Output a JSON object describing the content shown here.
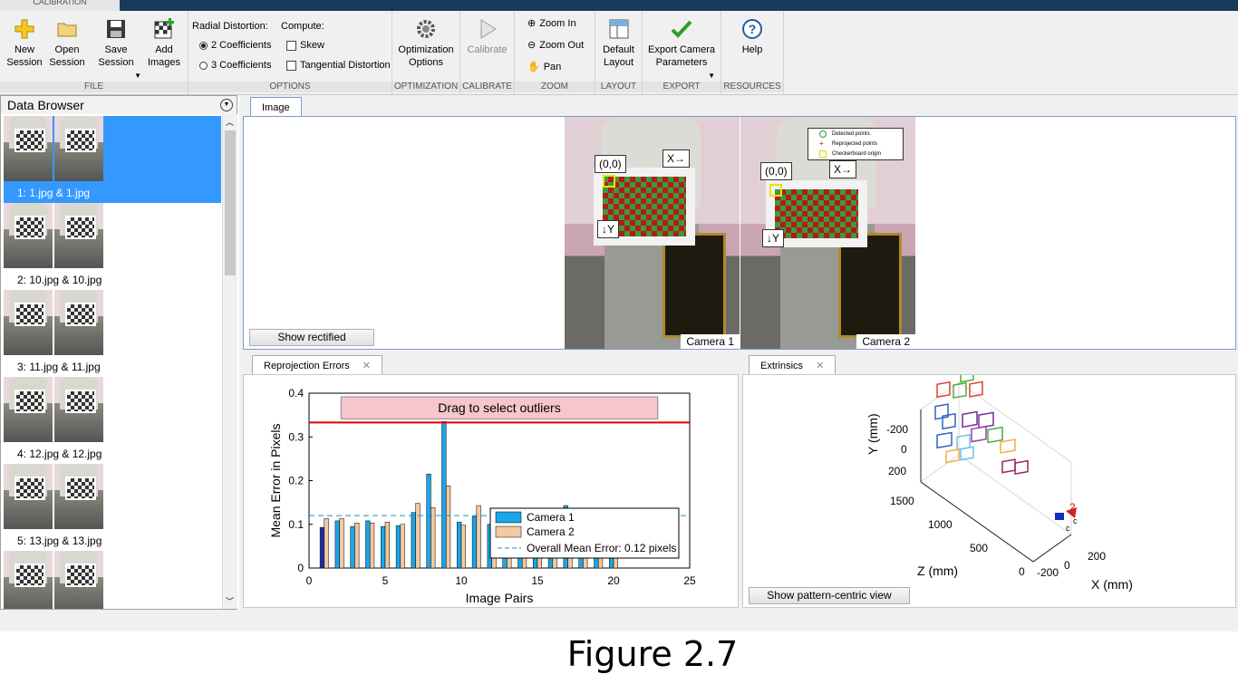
{
  "app_tab": "CALIBRATION",
  "ribbon": {
    "file": {
      "label": "FILE",
      "new_session": "New\nSession",
      "open_session": "Open\nSession",
      "save_session": "Save\nSession",
      "add_images": "Add\nImages"
    },
    "options": {
      "label": "OPTIONS",
      "radial_title": "Radial Distortion:",
      "compute_title": "Compute:",
      "two_coeff": "2 Coefficients",
      "three_coeff": "3 Coefficients",
      "skew": "Skew",
      "tangential": "Tangential Distortion"
    },
    "optimization": {
      "label": "OPTIMIZATION",
      "button": "Optimization\nOptions"
    },
    "calibrate": {
      "label": "CALIBRATE",
      "button": "Calibrate"
    },
    "zoom": {
      "label": "ZOOM",
      "zoom_in": "Zoom In",
      "zoom_out": "Zoom Out",
      "pan": "Pan"
    },
    "layout": {
      "label": "LAYOUT",
      "button": "Default\nLayout"
    },
    "export": {
      "label": "EXPORT",
      "button": "Export Camera\nParameters"
    },
    "resources": {
      "label": "RESOURCES",
      "button": "Help"
    }
  },
  "browser": {
    "title": "Data Browser",
    "items": [
      {
        "label": "1: 1.jpg & 1.jpg",
        "selected": true
      },
      {
        "label": "2: 10.jpg & 10.jpg",
        "selected": false
      },
      {
        "label": "3: 11.jpg & 11.jpg",
        "selected": false
      },
      {
        "label": "4: 12.jpg & 12.jpg",
        "selected": false
      },
      {
        "label": "5: 13.jpg & 13.jpg",
        "selected": false
      }
    ]
  },
  "image_panel": {
    "tab": "Image",
    "show_rectified": "Show rectified",
    "camera1": "Camera 1",
    "camera2": "Camera 2",
    "origin": "(0,0)",
    "x_axis": "X→",
    "y_axis": "↓Y",
    "legend": [
      "Detected points",
      "Reprojected points",
      "Checkerboard origin"
    ]
  },
  "reproj_panel": {
    "tab": "Reprojection Errors",
    "drag_text": "Drag to select outliers"
  },
  "extrinsics_panel": {
    "tab": "Extrinsics",
    "button": "Show pattern-centric view",
    "y_label": "Y (mm)",
    "z_label": "Z (mm)",
    "x_label": "X (mm)",
    "y_ticks": [
      "-200",
      "0",
      "200"
    ],
    "z_ticks": [
      "1500",
      "1000",
      "500",
      "0"
    ],
    "x_ticks": [
      "-200",
      "0",
      "200"
    ],
    "cam_labels": [
      "2",
      "c",
      "c"
    ]
  },
  "chart_data": {
    "type": "bar",
    "xlabel": "Image Pairs",
    "ylabel": "Mean Error in Pixels",
    "xlim": [
      0,
      25
    ],
    "ylim": [
      0,
      0.4
    ],
    "xticks": [
      0,
      5,
      10,
      15,
      20,
      25
    ],
    "yticks": [
      0,
      0.1,
      0.2,
      0.3,
      0.4
    ],
    "categories": [
      1,
      2,
      3,
      4,
      5,
      6,
      7,
      8,
      9,
      10,
      11,
      12,
      13,
      14,
      15,
      16,
      17,
      18,
      19,
      20
    ],
    "series": [
      {
        "name": "Camera 1",
        "color": "#1aa6e8",
        "values": [
          0.093,
          0.108,
          0.095,
          0.108,
          0.095,
          0.097,
          0.127,
          0.215,
          0.335,
          0.105,
          0.118,
          0.1,
          0.09,
          0.1,
          0.095,
          0.1,
          0.143,
          0.1,
          0.09,
          0.1
        ]
      },
      {
        "name": "Camera 2",
        "color": "#f3c9a1",
        "values": [
          0.113,
          0.113,
          0.103,
          0.103,
          0.105,
          0.1,
          0.148,
          0.138,
          0.188,
          0.098,
          0.143,
          0.11,
          0.1,
          0.11,
          0.1,
          0.105,
          0.12,
          0.105,
          0.095,
          0.098
        ]
      }
    ],
    "mean_line": {
      "label": "Overall Mean Error: 0.12 pixels",
      "value": 0.12
    },
    "threshold": 0.333,
    "legend_position": "lower-right"
  },
  "figure_caption": "Figure 2.7",
  "colors": {
    "selection": "#3399ff",
    "tab_strip": "#1a3a5c",
    "threshold": "#e00000",
    "drag_box": "#f7c6cc"
  }
}
